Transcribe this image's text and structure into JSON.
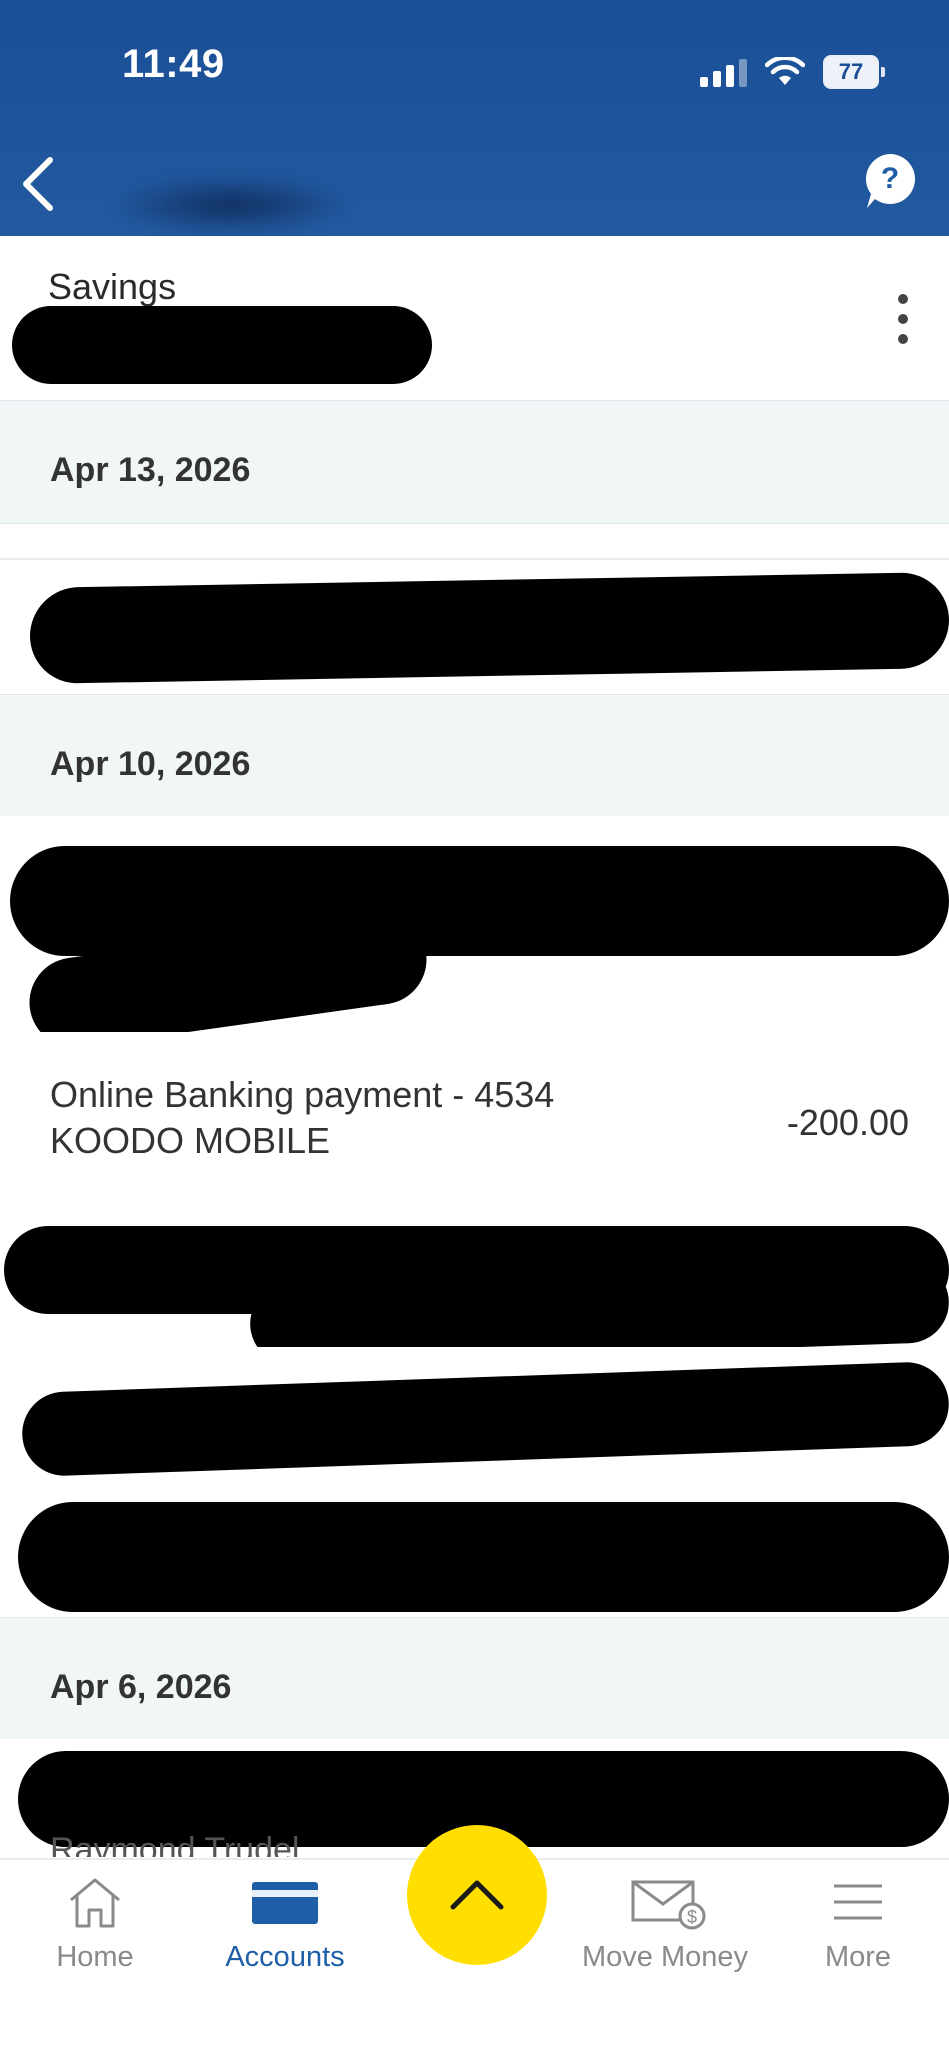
{
  "status_bar": {
    "time": "11:49",
    "battery": "77"
  },
  "account": {
    "title": "Savings"
  },
  "sections": [
    {
      "date": "Apr 13, 2026"
    },
    {
      "date": "Apr 10, 2026"
    },
    {
      "date": "Apr 6, 2026"
    }
  ],
  "transactions": {
    "koodo": {
      "description": "Online Banking payment - 4534\nKOODO MOBILE",
      "amount": "-200.00"
    },
    "partial_text": "Raymond Trudel"
  },
  "nav": {
    "home": "Home",
    "accounts": "Accounts",
    "move_money": "Move Money",
    "more": "More"
  },
  "colors": {
    "header": "#1a4f96",
    "accent": "#1f5fa8",
    "fab": "#ffde00"
  }
}
